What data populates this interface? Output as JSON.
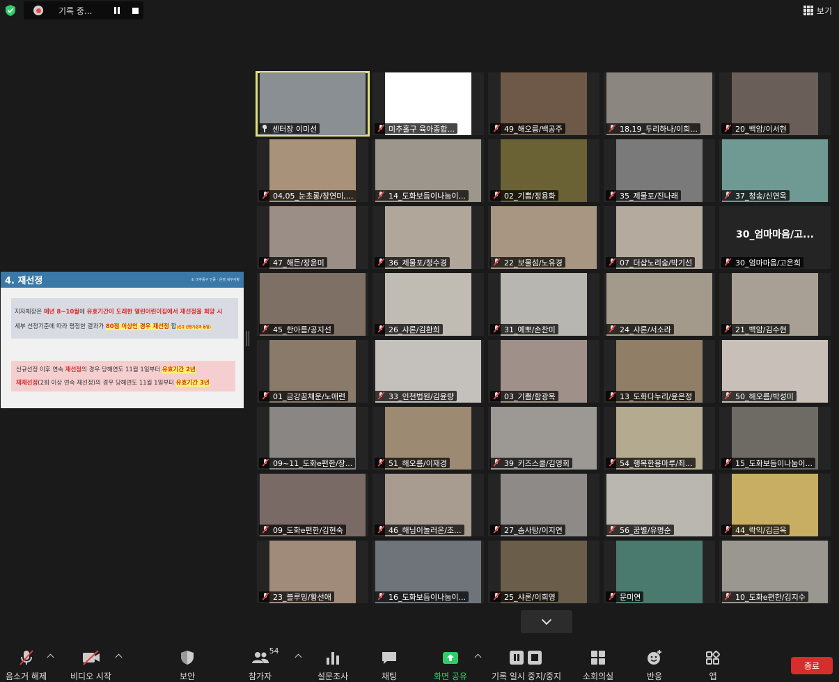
{
  "recording": {
    "status_text": "기록 중..."
  },
  "view": {
    "label": "보기"
  },
  "slide": {
    "title": "4. 재선정",
    "subtitle": "Ⅱ. 미추홀구 인증 · 운영 세부사항",
    "line1_a": "지자체장은 ",
    "line1_b": "매년 8~10월",
    "line1_c": "에 ",
    "line1_d": "유효기간이 도래한 열린어린이집에서 재선정을 희망 시",
    "line2_a": "세부 선정기준에 따라 평정한 결과가 ",
    "line2_b": "80점 이상인 경우 재선정",
    "line2_c": " 함",
    "line2_d": "(신규 선정기준과 동일)",
    "line3_a": "신규선정 이후 연속 ",
    "line3_b": "재선정",
    "line3_c": "의 경우 당해연도 11월 1일부터 ",
    "line3_d": "유효기간 2년",
    "line4_a": "재재선정",
    "line4_b": "(2회 이상 연속 재선정)의 경우 당해연도 11월 1일부터 ",
    "line4_c": "유효기간 3년"
  },
  "participants": [
    {
      "label": "센터장 이미선",
      "muted": false,
      "pinned": true,
      "active": true,
      "bg": "#8a8f94"
    },
    {
      "label": "미추홀구 육아종합...",
      "muted": true,
      "bg": "#ffffff"
    },
    {
      "label": "49_해오름/백공주",
      "muted": true,
      "bg": "#6e5848"
    },
    {
      "label": "18,19_두리하나/이희...",
      "muted": true,
      "bg": "#8c8680"
    },
    {
      "label": "20_백암/이서현",
      "muted": true,
      "bg": "#6a5f58"
    },
    {
      "label": "04,05_눈초롱/장연미,...",
      "muted": true,
      "bg": "#a8927a"
    },
    {
      "label": "14_도화보듬이나눔이...",
      "muted": true,
      "bg": "#9c968c"
    },
    {
      "label": "02_기쁨/정용화",
      "muted": true,
      "bg": "#6a6234"
    },
    {
      "label": "35_제물포/진나래",
      "muted": true,
      "bg": "#7a7a7a"
    },
    {
      "label": "37_청송/신연옥",
      "muted": true,
      "bg": "#6f9a94"
    },
    {
      "label": "47_해든/장윤미",
      "muted": true,
      "bg": "#9a8e86"
    },
    {
      "label": "36_제물포/정수경",
      "muted": true,
      "bg": "#b0a69a"
    },
    {
      "label": "22_보물섬/노유경",
      "muted": true,
      "bg": "#a89682"
    },
    {
      "label": "07_더샵노리숲/박기선",
      "muted": true,
      "bg": "#b4aa9e"
    },
    {
      "label": "30_엄마마음/고은희",
      "muted": true,
      "bg": "#242424",
      "name_only": "30_엄마마음/고..."
    },
    {
      "label": "45_한아름/공지선",
      "muted": true,
      "bg": "#7e7064"
    },
    {
      "label": "26_샤론/김환희",
      "muted": true,
      "bg": "#c0bcb4"
    },
    {
      "label": "31_예뽀/손찬미",
      "muted": true,
      "bg": "#b8b6b0"
    },
    {
      "label": "24_샤론/서소라",
      "muted": true,
      "bg": "#a49a8c"
    },
    {
      "label": "21_백암/김수현",
      "muted": true,
      "bg": "#a8a094"
    },
    {
      "label": "01_금강꿈채운/노애련",
      "muted": true,
      "bg": "#8a7a6a"
    },
    {
      "label": "33_인천법원/김윤량",
      "muted": true,
      "bg": "#c4c0bc"
    },
    {
      "label": "03_기쁨/함광옥",
      "muted": true,
      "bg": "#a0908a"
    },
    {
      "label": "13_도화다누리/윤은정",
      "muted": true,
      "bg": "#907e66"
    },
    {
      "label": "50_해오름/박성미",
      "muted": true,
      "bg": "#c8c0b8"
    },
    {
      "label": "09~11_도화e편한/장...",
      "muted": true,
      "bg": "#8a8684"
    },
    {
      "label": "51_해오름/이재경",
      "muted": true,
      "bg": "#9c8a72"
    },
    {
      "label": "39_키즈스쿨/김영희",
      "muted": true,
      "bg": "#9c9894"
    },
    {
      "label": "54_행복한용마루/최...",
      "muted": true,
      "bg": "#b4aa90"
    },
    {
      "label": "15_도화보듬이나눔이...",
      "muted": true,
      "bg": "#6e6a64"
    },
    {
      "label": "09_도화e편한/김현숙",
      "muted": true,
      "bg": "#7a6a66"
    },
    {
      "label": "46_해님이놀러온/조...",
      "muted": true,
      "bg": "#a89c90"
    },
    {
      "label": "27_솜사탕/이지연",
      "muted": true,
      "bg": "#8e8a88"
    },
    {
      "label": "56_꿈별/유명순",
      "muted": true,
      "bg": "#bab6b0"
    },
    {
      "label": "44_락익/김금옥",
      "muted": true,
      "bg": "#c8ae62"
    },
    {
      "label": "23_블루밍/황선애",
      "muted": true,
      "bg": "#a08a7a"
    },
    {
      "label": "16_도화보듬이나눔이...",
      "muted": true,
      "bg": "#6e747a"
    },
    {
      "label": "25_샤론/이희영",
      "muted": true,
      "bg": "#6a5e4a"
    },
    {
      "label": "문미연",
      "muted": true,
      "bg": "#4a7a6e"
    },
    {
      "label": "10_도화e편한/김지수",
      "muted": true,
      "bg": "#9a9690"
    }
  ],
  "toolbar": {
    "unmute": "음소거 해제",
    "start_video": "비디오 시작",
    "security": "보안",
    "participants": "참가자",
    "participants_count": "54",
    "polls": "설문조사",
    "chat": "채팅",
    "share_screen": "화면 공유",
    "recording_control": "기록 일시 중지/중지",
    "breakout": "소회의실",
    "reactions": "반응",
    "apps": "앱",
    "end": "종료"
  },
  "colors": {
    "share_green": "#2fcc6a",
    "end_red": "#d62d2d",
    "active_border": "#e3e27a",
    "slide_header": "#3a78a8"
  }
}
